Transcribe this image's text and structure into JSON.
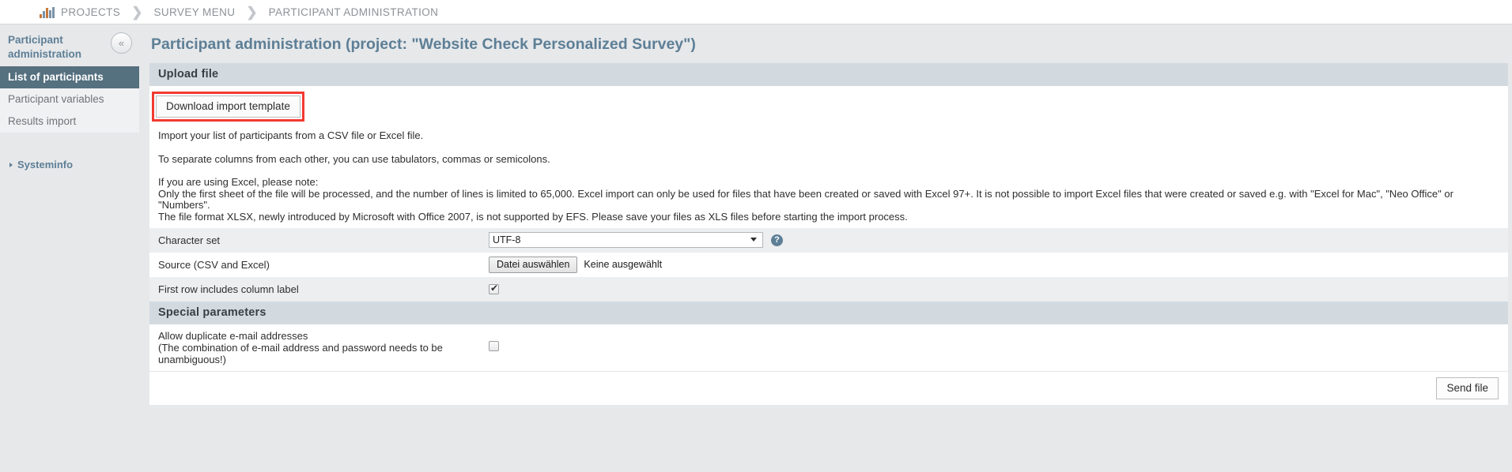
{
  "breadcrumb": {
    "icon": "bar-chart-icon",
    "items": [
      "PROJECTS",
      "SURVEY MENU",
      "PARTICIPANT ADMINISTRATION"
    ],
    "separator": "❯"
  },
  "sidebar": {
    "title": "Participant administration",
    "collapse_label": "«",
    "items": [
      {
        "label": "List of participants",
        "active": true
      },
      {
        "label": "Participant variables",
        "active": false
      },
      {
        "label": "Results import",
        "active": false
      }
    ],
    "systeminfo": "Systeminfo"
  },
  "main": {
    "page_title": "Participant administration (project: \"Website Check Personalized Survey\")",
    "upload_section": {
      "heading": "Upload file",
      "download_button": "Download import template",
      "highlight_color": "#f23a31",
      "intro_1": "Import your list of participants from a CSV file or Excel file.",
      "intro_2": "To separate columns from each other, you can use tabulators, commas or semicolons.",
      "note_heading": "If you are using Excel, please note:",
      "note_line_1": "Only the first sheet of the file will be processed, and the number of lines is limited to 65,000. Excel import can only be used for files that have been created or saved with Excel 97+. It is not possible to import Excel files that were created or saved e.g. with \"Excel for Mac\", \"Neo Office\" or \"Numbers\".",
      "note_line_2": "The file format XLSX, newly introduced by Microsoft with Office 2007, is not supported by EFS. Please save your files as XLS files before starting the import process.",
      "fields": {
        "charset_label": "Character set",
        "charset_value": "UTF-8",
        "charset_options": [
          "UTF-8"
        ],
        "help_icon": "question-mark-icon",
        "source_label": "Source (CSV and Excel)",
        "file_button": "Datei auswählen",
        "file_status": "Keine ausgewählt",
        "first_row_label": "First row includes column label",
        "first_row_checked": true
      }
    },
    "special_section": {
      "heading": "Special parameters",
      "duplicate_label_line1": "Allow duplicate e-mail addresses",
      "duplicate_label_line2": "(The combination of e-mail address and password needs to be",
      "duplicate_label_line3": "unambiguous!)",
      "duplicate_checked": false
    },
    "send_button": "Send file"
  }
}
